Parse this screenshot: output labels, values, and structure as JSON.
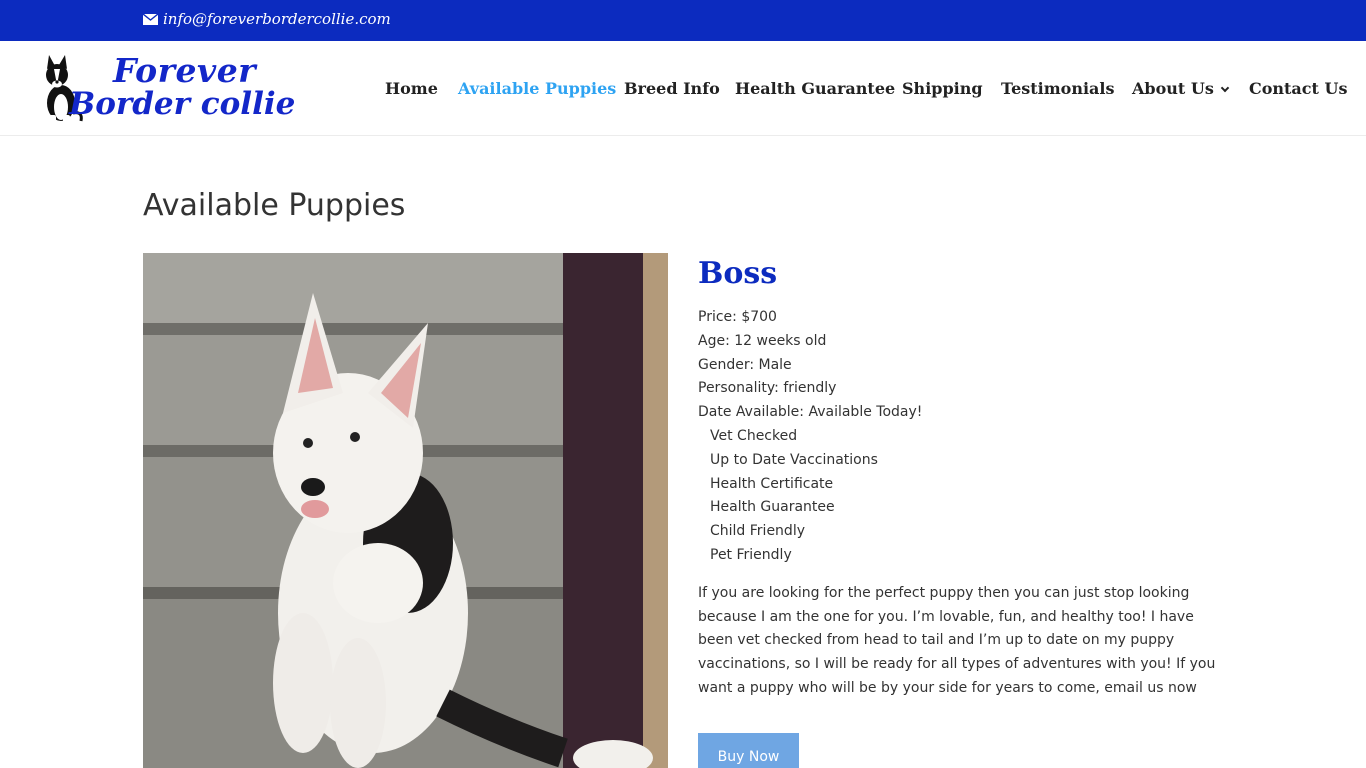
{
  "topbar": {
    "email": "info@foreverbordercollie.com"
  },
  "header": {
    "logo_line1": "Forever",
    "logo_line2": "Border collie",
    "nav": [
      {
        "label": "Home",
        "active": false
      },
      {
        "label": "Available Puppies",
        "active": true
      },
      {
        "label": "Breed Info",
        "active": false
      },
      {
        "label": "Health Guarantee",
        "active": false
      },
      {
        "label": "Shipping",
        "active": false
      },
      {
        "label": "Testimonials",
        "active": false
      },
      {
        "label": "About Us",
        "active": false,
        "has_dropdown": true
      },
      {
        "label": "Contact Us",
        "active": false
      }
    ]
  },
  "main": {
    "page_title": "Available Puppies",
    "puppy": {
      "name": "Boss",
      "info": [
        "Price: $700",
        "Age: 12 weeks old",
        "Gender: Male",
        "Personality: friendly",
        "Date Available: Available Today!"
      ],
      "features": [
        "Vet Checked",
        "Up to Date Vaccinations",
        "Health Certificate",
        "Health Guarantee",
        "Child Friendly",
        "Pet Friendly"
      ],
      "description": "If you are looking for the perfect puppy then you can just stop looking because I am the one for you. I’m lovable, fun, and healthy too! I have been vet checked from head to tail and I’m up to date on my puppy vaccinations, so I will be ready for all types of adventures with you! If you want a puppy who will be by your side for years to come, email us now",
      "buy_label": "Buy Now"
    }
  },
  "colors": {
    "brand_blue": "#0c2bbf",
    "nav_active": "#2ea3f2",
    "button": "#6fa6e3"
  },
  "icons": {
    "email": "envelope-icon",
    "dropdown": "chevron-down-icon"
  }
}
